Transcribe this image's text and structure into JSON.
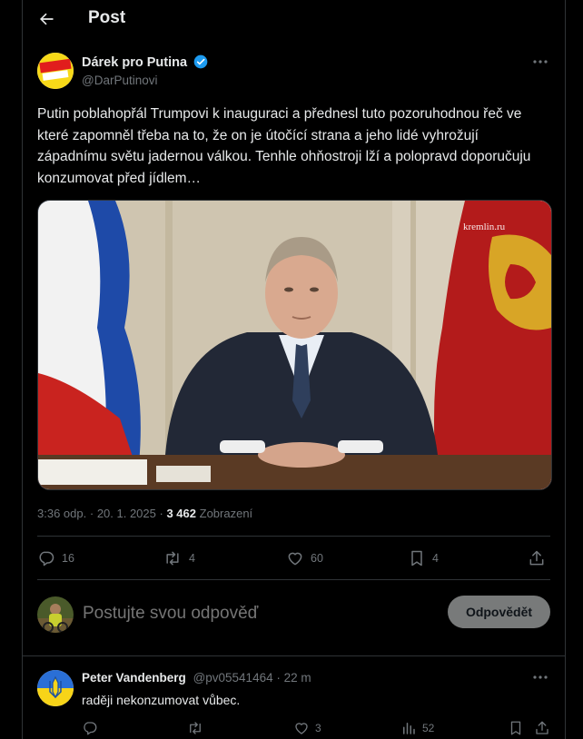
{
  "header": {
    "title": "Post",
    "back_icon": "arrow-left-icon"
  },
  "author": {
    "name": "Dárek pro Putina",
    "handle": "@DarPutinovi",
    "avatar_text_top": "DÁREK",
    "avatar_text_bottom": "PRO PUTINA",
    "verified_color": "#1d9bf0"
  },
  "post": {
    "text": "Putin poblahopřál Trumpovi k inauguraci a přednesl tuto pozoruhodnou řeč ve které zapomněl třeba na to, že on je útočící strana a jeho lidé vyhrožují západnímu světu jadernou válkou. Tenhle ohňostroji lží a polopravd doporučuju konzumovat před jídlem…",
    "media_watermark": "kremlin.ru"
  },
  "meta": {
    "time": "3:36 odp.",
    "dot": "·",
    "date": "20. 1. 2025",
    "views_count": "3 462",
    "views_label": "Zobrazení"
  },
  "actions": {
    "replies": "16",
    "reposts": "4",
    "likes": "60",
    "bookmarks": "4"
  },
  "reply_box": {
    "placeholder": "Postujte svou odpověď",
    "button_label": "Odpovědět"
  },
  "reply": {
    "name": "Peter Vandenberg",
    "handle": "@pv05541464",
    "dot": "·",
    "time": "22 m",
    "text": "raději nekonzumovat vůbec.",
    "likes": "3",
    "views": "52"
  },
  "colors": {
    "background": "#000000",
    "text": "#e7e9ea",
    "muted": "#71767b",
    "border": "#2f3336",
    "accent": "#1d9bf0"
  }
}
